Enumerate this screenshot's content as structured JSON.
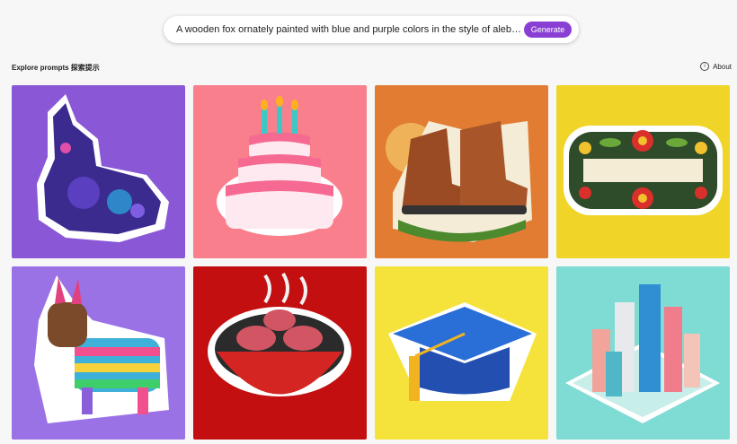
{
  "prompt": {
    "text": "A wooden fox ornately painted with blue and purple colors in the style of alebrijes.",
    "generate_label": "Generate"
  },
  "explore": {
    "title": "Explore prompts 探索提示",
    "about_label": "About"
  },
  "tiles": [
    {
      "subject": "alebrije-fox",
      "background": "#8a57d6"
    },
    {
      "subject": "birthday-cake",
      "background": "#f97f8c"
    },
    {
      "subject": "hiking-boots",
      "background": "#e27c33"
    },
    {
      "subject": "floral-banner",
      "background": "#f0d427"
    },
    {
      "subject": "pinata-donkey",
      "background": "#9b72e6"
    },
    {
      "subject": "bbq-grill",
      "background": "#c40f10"
    },
    {
      "subject": "graduation-cap",
      "background": "#f5e33c"
    },
    {
      "subject": "isometric-city",
      "background": "#7fdcd4"
    }
  ]
}
